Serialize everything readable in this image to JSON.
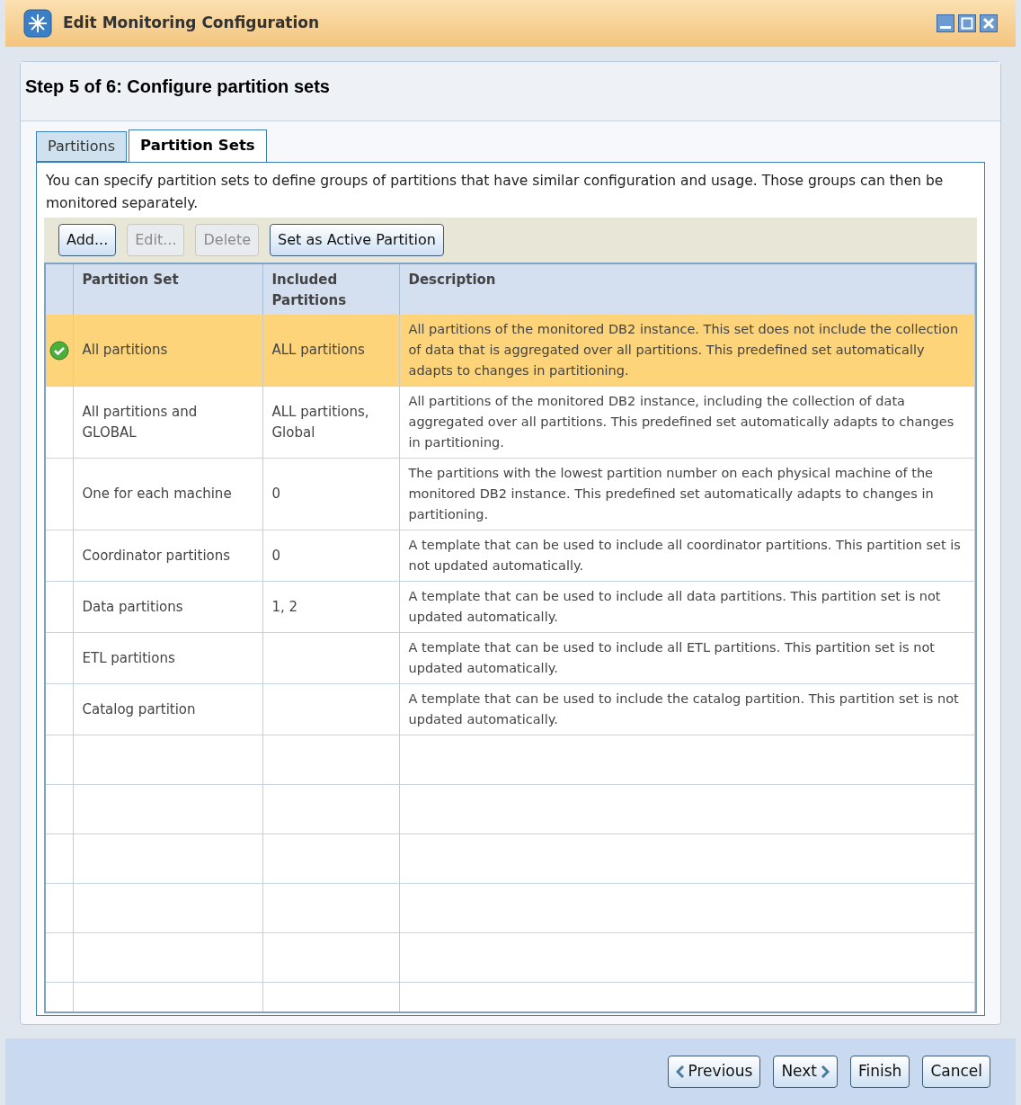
{
  "window": {
    "title": "Edit Monitoring Configuration"
  },
  "step_title": "Step 5 of 6: Configure partition sets",
  "tabs": [
    {
      "label": "Partitions",
      "selected": false
    },
    {
      "label": "Partition Sets",
      "selected": true
    }
  ],
  "intro": "You can specify partition sets to define groups of partitions that have similar configuration and usage. Those groups can then be monitored separately.",
  "toolbar": [
    {
      "label": "Add...",
      "disabled": false
    },
    {
      "label": "Edit...",
      "disabled": true
    },
    {
      "label": "Delete",
      "disabled": true
    },
    {
      "label": "Set as Active Partition",
      "disabled": false
    }
  ],
  "table": {
    "columns": [
      "Partition Set",
      "Included Partitions",
      "Description"
    ],
    "rows": [
      {
        "selected": true,
        "active": true,
        "cells": [
          "All partitions",
          "ALL partitions",
          "All partitions of the monitored DB2 instance. This set does not include the collection of data that is aggregated over all partitions. This predefined set automatically adapts to changes in partitioning."
        ]
      },
      {
        "selected": false,
        "active": false,
        "cells": [
          "All partitions and GLOBAL",
          "ALL partitions, Global",
          "All partitions of the monitored DB2 instance, including the collection of data aggregated over all partitions. This predefined set automatically adapts to changes in partitioning."
        ]
      },
      {
        "selected": false,
        "active": false,
        "cells": [
          "One for each machine",
          "0",
          "The partitions with the lowest partition number on each physical machine of the monitored DB2 instance. This predefined set automatically adapts to changes in partitioning."
        ]
      },
      {
        "selected": false,
        "active": false,
        "cells": [
          "Coordinator partitions",
          "0",
          "A template that can be used to include all coordinator partitions. This partition set is not updated automatically."
        ]
      },
      {
        "selected": false,
        "active": false,
        "cells": [
          "Data partitions",
          "1, 2",
          "A template that can be used to include all data partitions. This partition set is not updated automatically."
        ]
      },
      {
        "selected": false,
        "active": false,
        "cells": [
          "ETL partitions",
          "",
          "A template that can be used to include all ETL partitions. This partition set is not updated automatically."
        ]
      },
      {
        "selected": false,
        "active": false,
        "cells": [
          "Catalog partition",
          "",
          "A template that can be used to include the catalog partition. This partition set is not updated automatically."
        ]
      }
    ]
  },
  "footer_buttons": [
    {
      "kind": "previous",
      "label": "Previous"
    },
    {
      "kind": "next",
      "label": "Next"
    },
    {
      "kind": "plain",
      "label": "Finish"
    },
    {
      "kind": "plain",
      "label": "Cancel"
    }
  ]
}
